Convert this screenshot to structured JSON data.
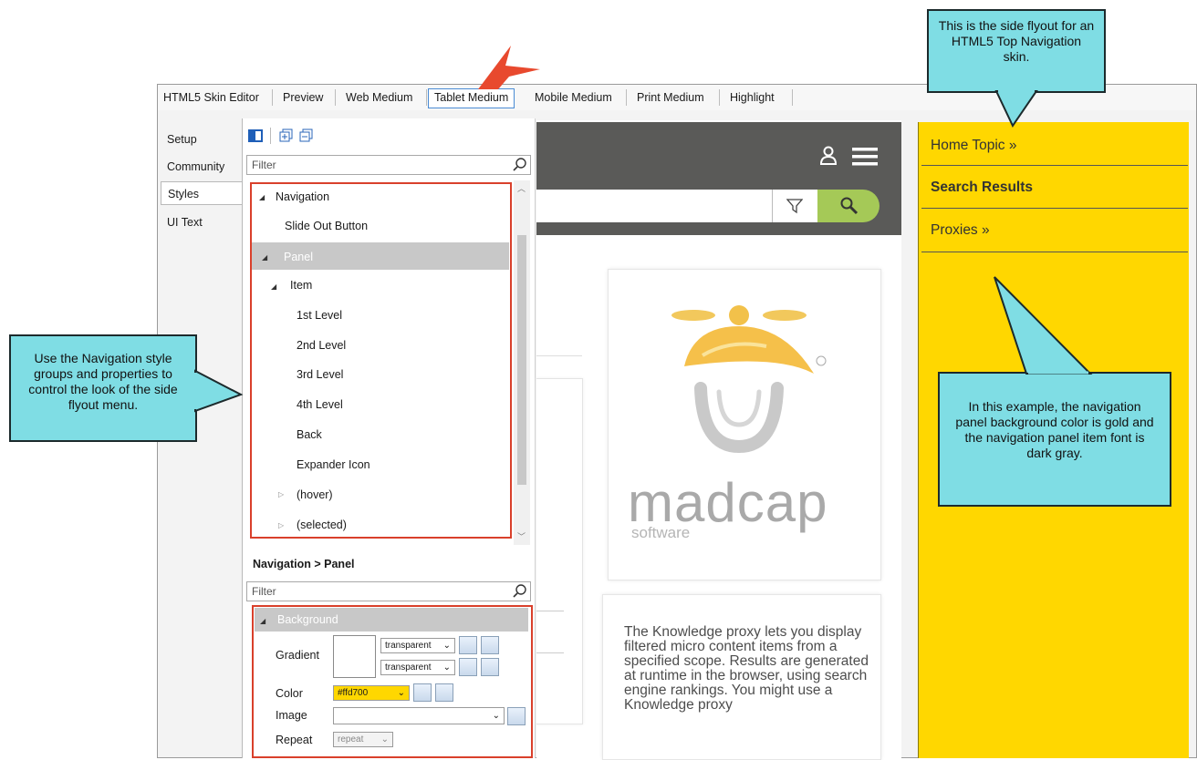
{
  "tabs": [
    "HTML5 Skin Editor",
    "Preview",
    "Web Medium",
    "Tablet Medium",
    "Mobile Medium",
    "Print Medium",
    "Highlight"
  ],
  "side_tabs": [
    "Setup",
    "Community",
    "Styles",
    "UI Text"
  ],
  "styles_panel": {
    "filter_placeholder": "Filter",
    "tree": {
      "navigation": "Navigation",
      "slide_out_button": "Slide Out Button",
      "panel": "Panel",
      "item": "Item",
      "level1": "1st Level",
      "level2": "2nd Level",
      "level3": "3rd Level",
      "level4": "4th Level",
      "back": "Back",
      "expander_icon": "Expander Icon",
      "hover": "(hover)",
      "selected": "(selected)"
    },
    "breadcrumb": "Navigation > Panel",
    "props_filter_placeholder": "Filter",
    "props": {
      "group": "Background",
      "gradient_label": "Gradient",
      "gradient_value_1": "transparent",
      "gradient_value_2": "transparent",
      "color_label": "Color",
      "color_value": "#ffd700",
      "image_label": "Image",
      "repeat_label": "Repeat",
      "repeat_value": "repeat"
    }
  },
  "preview": {
    "logo_word": "madcap",
    "logo_sub": "software",
    "body_text": "The Knowledge proxy lets you display filtered micro content items from a specified scope. Results are generated at runtime in the browser, using search engine rankings. You might use a Knowledge proxy"
  },
  "flyout": {
    "items": [
      "Home Topic  »",
      "Search Results",
      "Proxies  »"
    ],
    "background_color": "#ffd700"
  },
  "callouts": {
    "top_right": "This is the side flyout for an HTML5 Top Navigation skin.",
    "left": "Use the Navigation style groups and properties to control the look of the side flyout menu.",
    "right": "In this example, the navigation panel background color is gold and the navigation panel item font is dark gray."
  },
  "colors": {
    "accent_red": "#d9402b",
    "callout_cyan": "#7fdde4",
    "search_green": "#a5c957"
  }
}
